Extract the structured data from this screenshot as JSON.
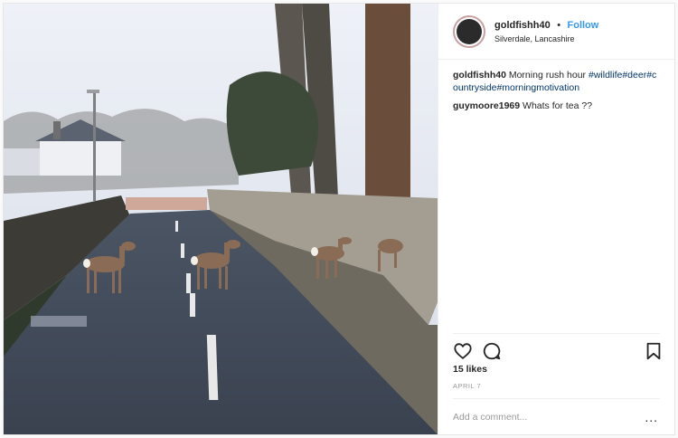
{
  "post": {
    "username": "goldfishh40",
    "dot": "•",
    "follow_label": "Follow",
    "location": "Silverdale, Lancashire"
  },
  "comments": [
    {
      "user": "goldfishh40",
      "text": "Morning rush hour",
      "tags": "#wildlife#deer#countryside#morningmotivation"
    },
    {
      "user": "guymoore1969",
      "text": "Whats for tea ??"
    }
  ],
  "engagement": {
    "likes": "15 likes",
    "date": "APRIL 7"
  },
  "composer": {
    "placeholder": "Add a comment...",
    "more": "..."
  },
  "icons": [
    "heart-icon",
    "comment-icon",
    "bookmark-icon",
    "more-options-icon"
  ],
  "colors": {
    "link": "#3897f0",
    "hashtag": "#003569",
    "muted": "#999999",
    "border": "#efefef"
  }
}
